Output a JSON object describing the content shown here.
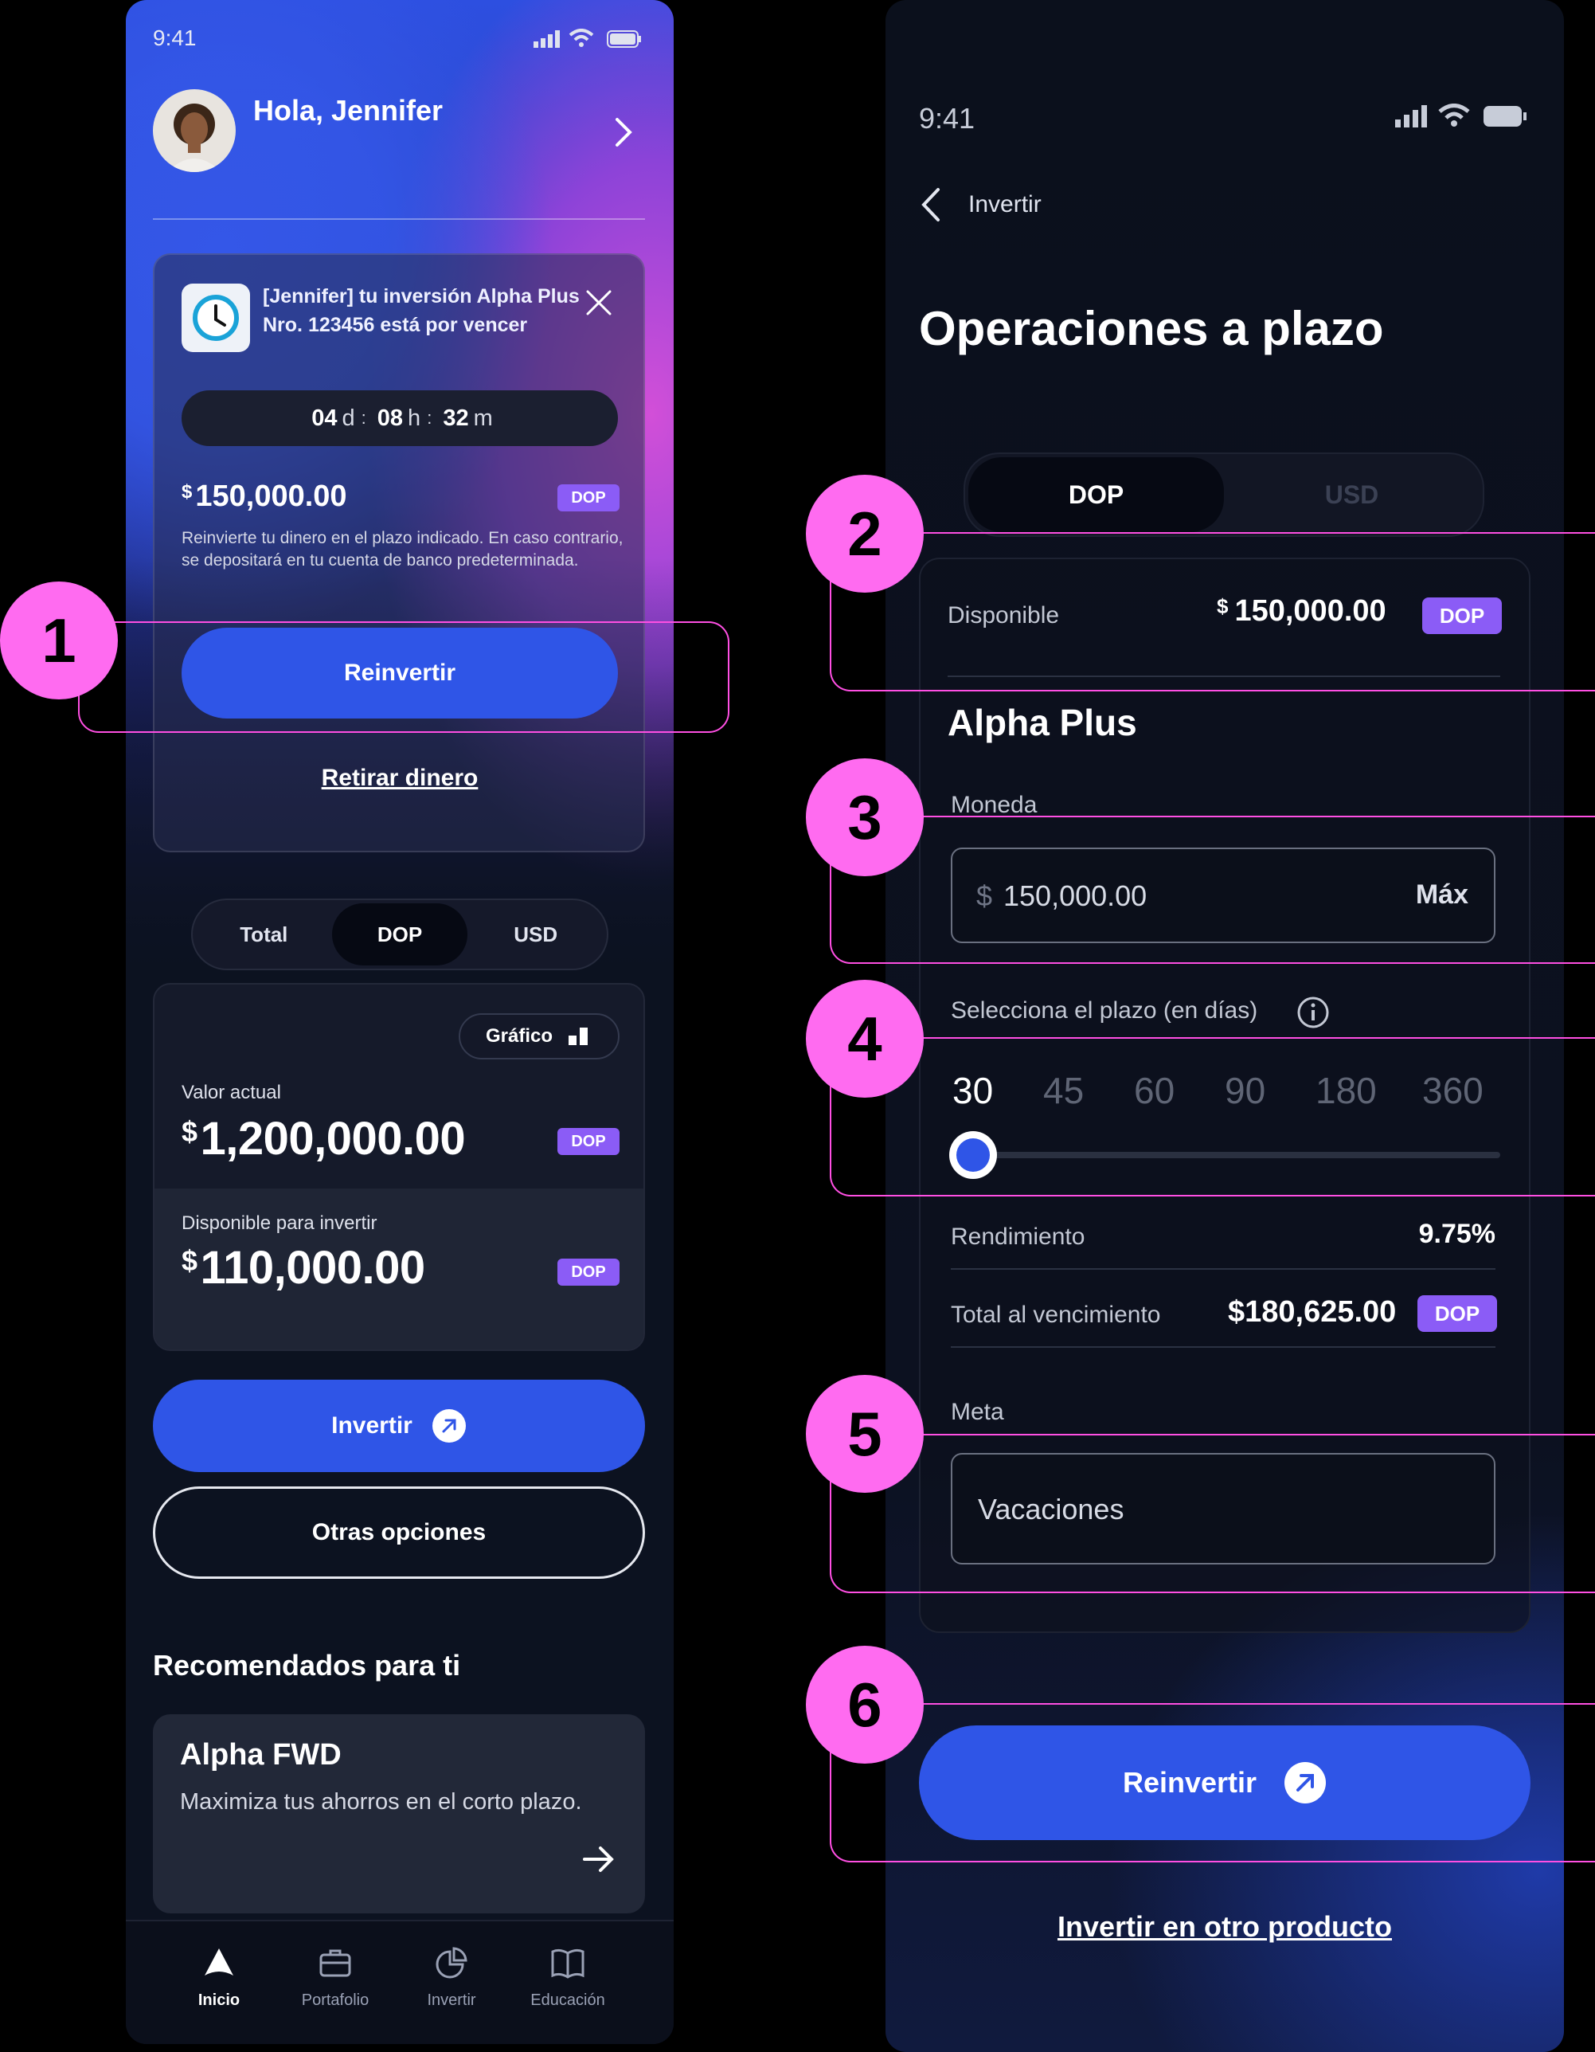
{
  "left_screen": {
    "status_time": "9:41",
    "greeting": "Hola, Jennifer",
    "notification": {
      "message": "[Jennifer] tu inversión Alpha Plus Nro. 123456 está por vencer",
      "timer": {
        "days": "04",
        "days_unit": "d",
        "hours": "08",
        "hours_unit": "h",
        "minutes": "32",
        "minutes_unit": "m",
        "separator": ":"
      },
      "currency_symbol": "$",
      "amount": "150,000.00",
      "badge": "DOP",
      "description": "Reinvierte tu dinero en el plazo indicado. En caso contrario, se depositará en tu cuenta de banco predeterminada.",
      "reinvest_label": "Reinvertir",
      "withdraw_label": "Retirar dinero"
    },
    "currency_tabs": [
      {
        "label": "Total",
        "active": false
      },
      {
        "label": "DOP",
        "active": true
      },
      {
        "label": "USD",
        "active": false
      }
    ],
    "chart_toggle_label": "Gráfico",
    "current_value_label": "Valor actual",
    "current_value_symbol": "$",
    "current_value": "1,200,000.00",
    "current_value_badge": "DOP",
    "available_label": "Disponible para invertir",
    "available_symbol": "$",
    "available_value": "110,000.00",
    "available_badge": "DOP",
    "invest_button": "Invertir",
    "other_options_button": "Otras opciones",
    "recommended_title": "Recomendados para ti",
    "recommended_card": {
      "title": "Alpha FWD",
      "subtitle": "Maximiza tus ahorros en el corto plazo."
    },
    "tabbar": [
      {
        "label": "Inicio",
        "icon": "home-icon",
        "active": true
      },
      {
        "label": "Portafolio",
        "icon": "briefcase-icon",
        "active": false
      },
      {
        "label": "Invertir",
        "icon": "pie-chart-icon",
        "active": false
      },
      {
        "label": "Educación",
        "icon": "book-icon",
        "active": false
      }
    ]
  },
  "right_screen": {
    "status_time": "9:41",
    "back_label": "Invertir",
    "title": "Operaciones a plazo",
    "currency_tabs": [
      {
        "label": "DOP",
        "active": true
      },
      {
        "label": "USD",
        "active": false
      }
    ],
    "available_label": "Disponible",
    "available_symbol": "$",
    "available_amount": "150,000.00",
    "available_badge": "DOP",
    "product_name": "Alpha Plus",
    "currency_field_label": "Moneda",
    "amount_prefix": "$",
    "amount_value": "150,000.00",
    "max_label": "Máx",
    "term_label": "Selecciona el plazo (en días)",
    "term_options": [
      "30",
      "45",
      "60",
      "90",
      "180",
      "360"
    ],
    "term_selected": "30",
    "yield_label": "Rendimiento",
    "yield_value": "9.75%",
    "maturity_label": "Total al vencimiento",
    "maturity_value": "$180,625.00",
    "maturity_badge": "DOP",
    "goal_label": "Meta",
    "goal_value": "Vacaciones",
    "reinvest_button": "Reinvertir",
    "other_product_link": "Invertir en otro producto"
  },
  "annotations": [
    "1",
    "2",
    "3",
    "4",
    "5",
    "6"
  ],
  "colors": {
    "primary_blue": "#2f55e7",
    "badge_purple": "#8b5cf6",
    "annotation_pink": "#ff6bf0",
    "dark_bg": "#0c1220"
  }
}
